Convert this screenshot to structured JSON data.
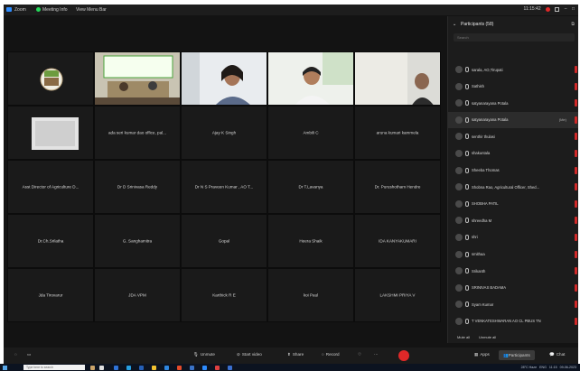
{
  "titlebar": {
    "app": "Zoom",
    "meeting_info": "Meeting Info",
    "view": "View Menu Bar",
    "time": "11:15:42"
  },
  "tiles": [
    {
      "name": "",
      "kind": "logo"
    },
    {
      "name": "",
      "kind": "video"
    },
    {
      "name": "",
      "kind": "video"
    },
    {
      "name": "",
      "kind": "video"
    },
    {
      "name": "",
      "kind": "video"
    },
    {
      "name": "",
      "kind": "photo"
    },
    {
      "name": "ada seri kumar dao office, pal...",
      "kind": "name"
    },
    {
      "name": "Ajay K Singh",
      "kind": "name"
    },
    {
      "name": "Ambili C",
      "kind": "name"
    },
    {
      "name": "aruna kumari kammela",
      "kind": "name"
    },
    {
      "name": "Asst Director of Agriculture D...",
      "kind": "name"
    },
    {
      "name": "Dr D Srinivasa Reddy",
      "kind": "name"
    },
    {
      "name": "Dr N S Praveen Kumar , AO T...",
      "kind": "name"
    },
    {
      "name": "Dr T.Lavanya",
      "kind": "name"
    },
    {
      "name": "Dr. Purushotham Hendre",
      "kind": "name"
    },
    {
      "name": "Dr.Ch.Srilatha",
      "kind": "name"
    },
    {
      "name": "G. Sanghamitra",
      "kind": "name"
    },
    {
      "name": "Gopal",
      "kind": "name"
    },
    {
      "name": "Heera Shaik",
      "kind": "name"
    },
    {
      "name": "IDA KANYAKUMARI",
      "kind": "name"
    },
    {
      "name": "Jda Tirovarur",
      "kind": "name"
    },
    {
      "name": "JDA VPM",
      "kind": "name"
    },
    {
      "name": "Karthick R E",
      "kind": "name"
    },
    {
      "name": "koi Paul",
      "kind": "name"
    },
    {
      "name": "LAKSHMI PRIYA V",
      "kind": "name"
    }
  ],
  "participants": {
    "title": "Participants (58)",
    "search_placeholder": "Search",
    "items": [
      {
        "name": "sarala, AO,Tirupati",
        "ext": ""
      },
      {
        "name": "Sathish",
        "ext": ""
      },
      {
        "name": "satyanarayana Potala",
        "ext": ""
      },
      {
        "name": "satyanarayana Potala",
        "ext": "(Me)"
      },
      {
        "name": "senthir thulasi",
        "ext": ""
      },
      {
        "name": "shakuntala",
        "ext": ""
      },
      {
        "name": "Sheeba Thomas",
        "ext": ""
      },
      {
        "name": "Shobna Rao, Agricultural Officer, Shed...",
        "ext": ""
      },
      {
        "name": "SHOBHA PATIL",
        "ext": ""
      },
      {
        "name": "shreedha M",
        "ext": ""
      },
      {
        "name": "shri",
        "ext": ""
      },
      {
        "name": "smithaa",
        "ext": ""
      },
      {
        "name": "Srikanth",
        "ext": ""
      },
      {
        "name": "SRINIVAS BADAMA",
        "ext": ""
      },
      {
        "name": "Syam Kumar",
        "ext": ""
      },
      {
        "name": "T VENKATESHWARAN AO CL PBUS TN",
        "ext": ""
      }
    ],
    "footer": [
      "Mute all",
      "Unmute all"
    ]
  },
  "toolbar": {
    "unmute": "Unmute",
    "start_video": "Start video",
    "share": "Share",
    "record": "Record",
    "apps": "Apps",
    "participants": "Participants",
    "chat": "Chat"
  },
  "taskbar": {
    "search": "Type here to search",
    "tray": "28°C Haze",
    "lang": "ENG",
    "time": "11:15",
    "date": "09-06-2023"
  },
  "colors": {
    "leave": "#e02828",
    "accent": "#2d8cff",
    "bg": "#131313"
  }
}
